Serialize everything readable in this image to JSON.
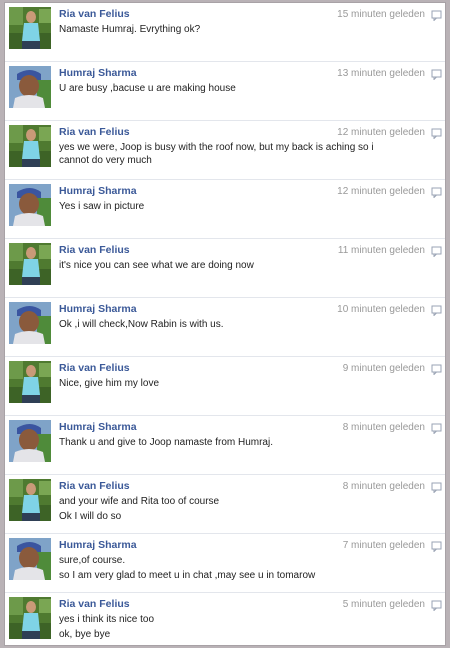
{
  "messages": [
    {
      "sender": "Ria van Felius",
      "avatar": "ria",
      "time": "15 minuten geleden",
      "lines": [
        "Namaste Humraj. Evrything ok?"
      ]
    },
    {
      "sender": "Humraj Sharma",
      "avatar": "humraj",
      "time": "13 minuten geleden",
      "lines": [
        "U are busy ,bacuse u are making house"
      ]
    },
    {
      "sender": "Ria van Felius",
      "avatar": "ria",
      "time": "12 minuten geleden",
      "lines": [
        "yes we were, Joop is busy with the roof now, but my back is aching so i cannot do very much"
      ]
    },
    {
      "sender": "Humraj Sharma",
      "avatar": "humraj",
      "time": "12 minuten geleden",
      "lines": [
        "Yes i saw in picture"
      ]
    },
    {
      "sender": "Ria van Felius",
      "avatar": "ria",
      "time": "11 minuten geleden",
      "lines": [
        "it's nice you can see what we are doing now"
      ]
    },
    {
      "sender": "Humraj Sharma",
      "avatar": "humraj",
      "time": "10 minuten geleden",
      "lines": [
        "Ok ,i will check,Now Rabin is with us."
      ]
    },
    {
      "sender": "Ria van Felius",
      "avatar": "ria",
      "time": "9 minuten geleden",
      "lines": [
        "Nice, give him my love"
      ]
    },
    {
      "sender": "Humraj Sharma",
      "avatar": "humraj",
      "time": "8 minuten geleden",
      "lines": [
        "Thank u and give to Joop namaste from Humraj."
      ]
    },
    {
      "sender": "Ria van Felius",
      "avatar": "ria",
      "time": "8 minuten geleden",
      "lines": [
        "and your wife and Rita too of course",
        "Ok I will do so"
      ]
    },
    {
      "sender": "Humraj Sharma",
      "avatar": "humraj",
      "time": "7 minuten geleden",
      "lines": [
        "sure,of course.",
        "so I am very glad to meet u in chat ,may see u in tomarow"
      ]
    },
    {
      "sender": "Ria van Felius",
      "avatar": "ria",
      "time": "5 minuten geleden",
      "lines": [
        "yes i think its nice too",
        "ok, bye bye"
      ]
    }
  ],
  "colors": {
    "sender_link": "#3b5998",
    "timestamp": "#999999",
    "divider": "#e3e6ec"
  },
  "icons": {
    "reply": "speech-bubble-icon"
  }
}
